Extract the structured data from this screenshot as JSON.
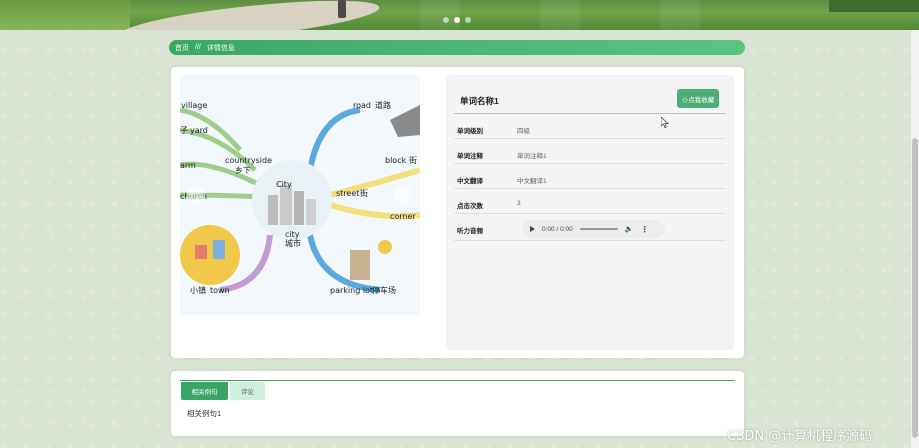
{
  "slider": {
    "dots": 3,
    "active_index": 1
  },
  "breadcrumb": {
    "home": "首页",
    "separator": "///",
    "current": "详情信息"
  },
  "mindmap": {
    "center_label": "City",
    "center_en": "city",
    "center_cn": "城市",
    "nodes": [
      {
        "en": "village",
        "cn": ""
      },
      {
        "en": "yard",
        "cn": "子"
      },
      {
        "en": "arm",
        "cn": ""
      },
      {
        "en": "countryside",
        "cn": "乡下"
      },
      {
        "en": "church",
        "cn": ""
      },
      {
        "en": "road",
        "cn": "道路"
      },
      {
        "en": "block",
        "cn": "街"
      },
      {
        "en": "street",
        "cn": "街"
      },
      {
        "en": "corner",
        "cn": ""
      },
      {
        "en": "town",
        "cn": "小镇"
      },
      {
        "en": "parking lot",
        "cn": "停车场"
      }
    ]
  },
  "detail": {
    "title": "单词名称1",
    "favorite_label": "☆点我收藏",
    "rows": [
      {
        "label": "单词级别",
        "value": "四级"
      },
      {
        "label": "单词注释",
        "value": "单词注释1"
      },
      {
        "label": "中文翻译",
        "value": "中文翻译1"
      },
      {
        "label": "点击次数",
        "value": "3"
      },
      {
        "label": "听力音频",
        "value": ""
      }
    ],
    "audio": {
      "time": "0:00 / 0:00"
    }
  },
  "tabs": {
    "items": [
      {
        "label": "相关例句",
        "active": true
      },
      {
        "label": "评论",
        "active": false
      }
    ],
    "content": "相关例句1"
  },
  "watermark": "CSDN @计算机程序源码",
  "colors": {
    "primary": "#3aa467",
    "background": "#d9e4d3"
  }
}
